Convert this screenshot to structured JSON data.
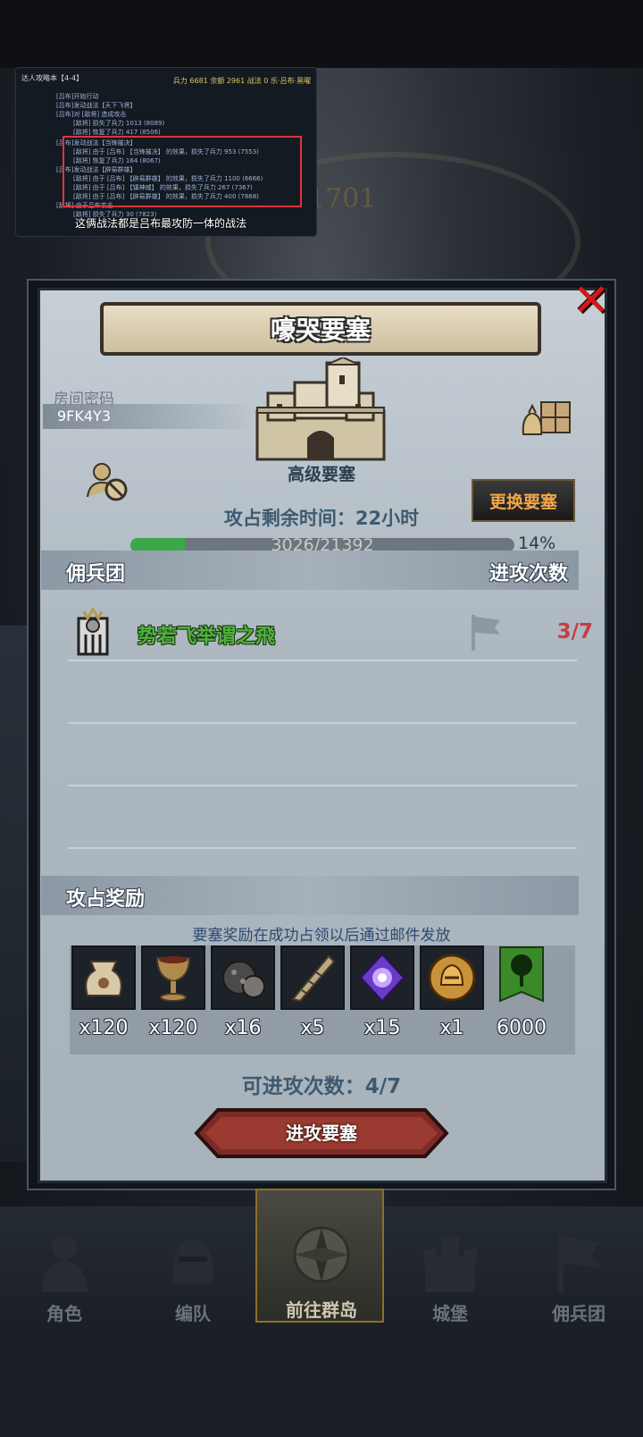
{
  "overlay": {
    "header": "达人攻略本【4-4】",
    "stats": "兵力 6681  余额 2961  战法 0  乐·吕布·黑曜",
    "lines": [
      "[吕布]开始行动",
      "[吕布]发动战法【天下飞将】",
      "[吕布]对 [敌将] 造成攻击",
      "[敌将] 损失了兵力 1013 (8089)",
      "[敌将] 恢复了兵力 417 (8506)",
      "[吕布]发动战法【当锋摧决】",
      "[敌将] 由于 [吕布] 【当锋摧决】 的效果，损失了兵力 953 (7553)",
      "[敌将] 恢复了兵力 164 (8067)",
      "[吕布]发动战法【辟易群雄】",
      "[敌将] 由于 [吕布] 【辟易群雄】 的效果，损失了兵力 1100 (6666)",
      "[敌将] 由于 [吕布] 【镇神威】 的效果，损失了兵力 267 (7367)",
      "[敌将] 由于 [吕布] 【辟易群雄】 的效果，损失了兵力 400 (7868)",
      "[敌将] 由于吕布攻击",
      "[敌将] 损失了兵力 30 (7823)"
    ],
    "subtitle": "这俩战法都是吕布最攻防一体的战法"
  },
  "background": {
    "number": "1701"
  },
  "dialog": {
    "title": "嚎哭要塞",
    "room_label": "房间密码",
    "room_code": "9FK4Y3",
    "fortress_level": "高级要塞",
    "change_button": "更换要塞",
    "countdown": "攻占剩余时间：22小时",
    "progress": {
      "text": "3026/21392",
      "current": 3026,
      "total": 21392,
      "percent_label": "14%"
    },
    "mercenary_section": {
      "title": "佣兵团",
      "right_title": "进攻次数",
      "rows": [
        {
          "name": "势若飞举谓之飛",
          "count": "3/7"
        }
      ]
    },
    "reward_section": {
      "title": "攻占奖励",
      "note": "要塞奖励在成功占领以后通过邮件发放",
      "items": [
        {
          "icon": "sack-icon",
          "qty": "x120"
        },
        {
          "icon": "goblet-icon",
          "qty": "x120"
        },
        {
          "icon": "ore-icon",
          "qty": "x16"
        },
        {
          "icon": "horn-icon",
          "qty": "x5"
        },
        {
          "icon": "crystal-icon",
          "qty": "x15"
        },
        {
          "icon": "helmet-medal-icon",
          "qty": "x1"
        },
        {
          "icon": "tree-banner-icon",
          "qty": "6000"
        }
      ]
    },
    "attacks_left": "可进攻次数：4/7",
    "attack_button": "进攻要塞"
  },
  "nav": {
    "items": [
      {
        "label": "角色",
        "icon": "knight-icon"
      },
      {
        "label": "编队",
        "icon": "helmet-icon"
      },
      {
        "label": "前往群岛",
        "icon": "compass-icon",
        "active": true
      },
      {
        "label": "城堡",
        "icon": "castle-icon"
      },
      {
        "label": "佣兵团",
        "icon": "mercenary-icon"
      }
    ]
  },
  "colors": {
    "progress_fill": "#3aa84a",
    "mercenary_name": "#4fb33c",
    "attack_count": "#c24043",
    "change_button_text": "#f2a64a",
    "close_x": "#d01a1a"
  }
}
